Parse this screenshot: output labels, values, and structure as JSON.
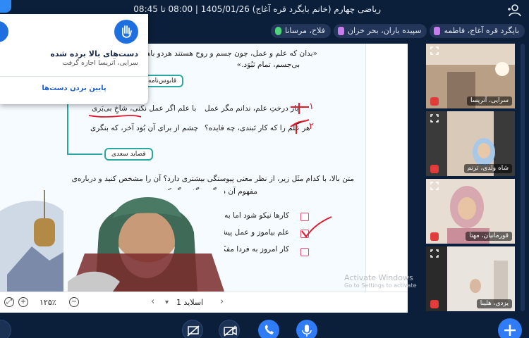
{
  "header": {
    "title": "ریاضی چهارم (خانم بایگرد قره آغاج) 1405/01/26 | 08:00 تا 08:45"
  },
  "chips": [
    {
      "label": "بایگرد قره آغاج، فاطمه",
      "icon": "hand-icon"
    },
    {
      "label": "سپیده باران، بحر خزان",
      "icon": "hand-icon"
    },
    {
      "label": "فلاح، مرسانا",
      "icon": "mic-icon"
    }
  ],
  "popup": {
    "heading": "دست‌های بالا برده شده",
    "subtitle": "سرایی، آتریسا اجازه گرفت",
    "action": "پایین بردن دست‌ها"
  },
  "slide": {
    "quote_line1": "«بدان که علم و عمل، چون جسم و روح هستند هردو باهم؛",
    "quote_line2": "بی‌جسم، تمام نَبُوَد.»",
    "tag_top": "قابوس‌نامه",
    "poem1_a": "بار درختِ علم، ندانم مگر عمل",
    "poem1_b": "با علم اگر عمل نکنی، شاخِ بی‌بَری",
    "poem2_a": "هر علم را که کار نَبندی، چه فایده؟",
    "poem2_b": "چشم از برای آن بُوَد آخر، که بنگری",
    "tag_bottom": "قصاید سعدی",
    "question_line1": "متن بالا، با کدام مثَل زیر، از نظر معنی پیوستگی بیشتری دارد؟ آن را مشخص کنید و درباره‌ی",
    "question_line2": "مفهوم آن در گروه گفت‌وگو کنید:",
    "options": [
      "کارها نیکو شود اما به صبر.",
      "علم بیاموز و عمل پیشه کن.",
      "کار امروز به فردا مفکن."
    ],
    "annotation_1": "۱",
    "annotation_2": "۲"
  },
  "slide_footer": {
    "page_label": "اسلاید 1",
    "zoom": "۱۲۵٪"
  },
  "watermark": {
    "line1": "Activate Windows",
    "line2": "Go to Settings to activate"
  },
  "participants": [
    {
      "name": "سرایی، آتریسا"
    },
    {
      "name": "شاه ولدی، ترنم"
    },
    {
      "name": "قورمانیان، مهتا"
    },
    {
      "name": "یزدی، هلینا"
    }
  ],
  "colors": {
    "background": "#0b1f3a",
    "accent": "#2f7cf6",
    "teal": "#2aa8a0",
    "annotation_red": "#e2182c"
  }
}
